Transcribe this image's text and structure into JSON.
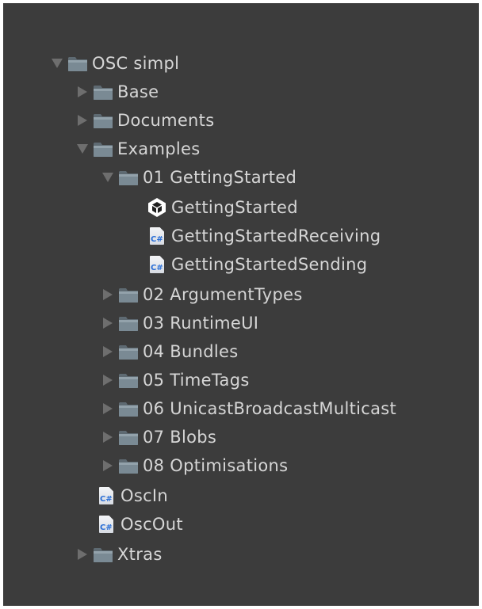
{
  "tree": {
    "items": [
      {
        "label": "OSC simpl",
        "icon": "folder-icon",
        "expanded": true
      },
      {
        "label": "Base",
        "icon": "folder-icon",
        "expanded": false
      },
      {
        "label": "Documents",
        "icon": "folder-icon",
        "expanded": false
      },
      {
        "label": "Examples",
        "icon": "folder-icon",
        "expanded": true
      },
      {
        "label": "01 GettingStarted",
        "icon": "folder-icon",
        "expanded": true
      },
      {
        "label": "GettingStarted",
        "icon": "unity-scene-icon"
      },
      {
        "label": "GettingStartedReceiving",
        "icon": "csharp-script-icon"
      },
      {
        "label": "GettingStartedSending",
        "icon": "csharp-script-icon"
      },
      {
        "label": "02 ArgumentTypes",
        "icon": "folder-icon",
        "expanded": false
      },
      {
        "label": "03 RuntimeUI",
        "icon": "folder-icon",
        "expanded": false
      },
      {
        "label": "04 Bundles",
        "icon": "folder-icon",
        "expanded": false
      },
      {
        "label": "05 TimeTags",
        "icon": "folder-icon",
        "expanded": false
      },
      {
        "label": "06 UnicastBroadcastMulticast",
        "icon": "folder-icon",
        "expanded": false
      },
      {
        "label": "07 Blobs",
        "icon": "folder-icon",
        "expanded": false
      },
      {
        "label": "08 Optimisations",
        "icon": "folder-icon",
        "expanded": false
      },
      {
        "label": "OscIn",
        "icon": "csharp-script-icon"
      },
      {
        "label": "OscOut",
        "icon": "csharp-script-icon"
      },
      {
        "label": "Xtras",
        "icon": "folder-icon",
        "expanded": false
      }
    ],
    "csharp_badge": "C#"
  },
  "colors": {
    "panel_background": "#3c3c3c",
    "text": "#d6d6d6",
    "arrow": "#6e6e6e",
    "folder": "#6f7f89",
    "csharp_text": "#2a6fd6"
  }
}
